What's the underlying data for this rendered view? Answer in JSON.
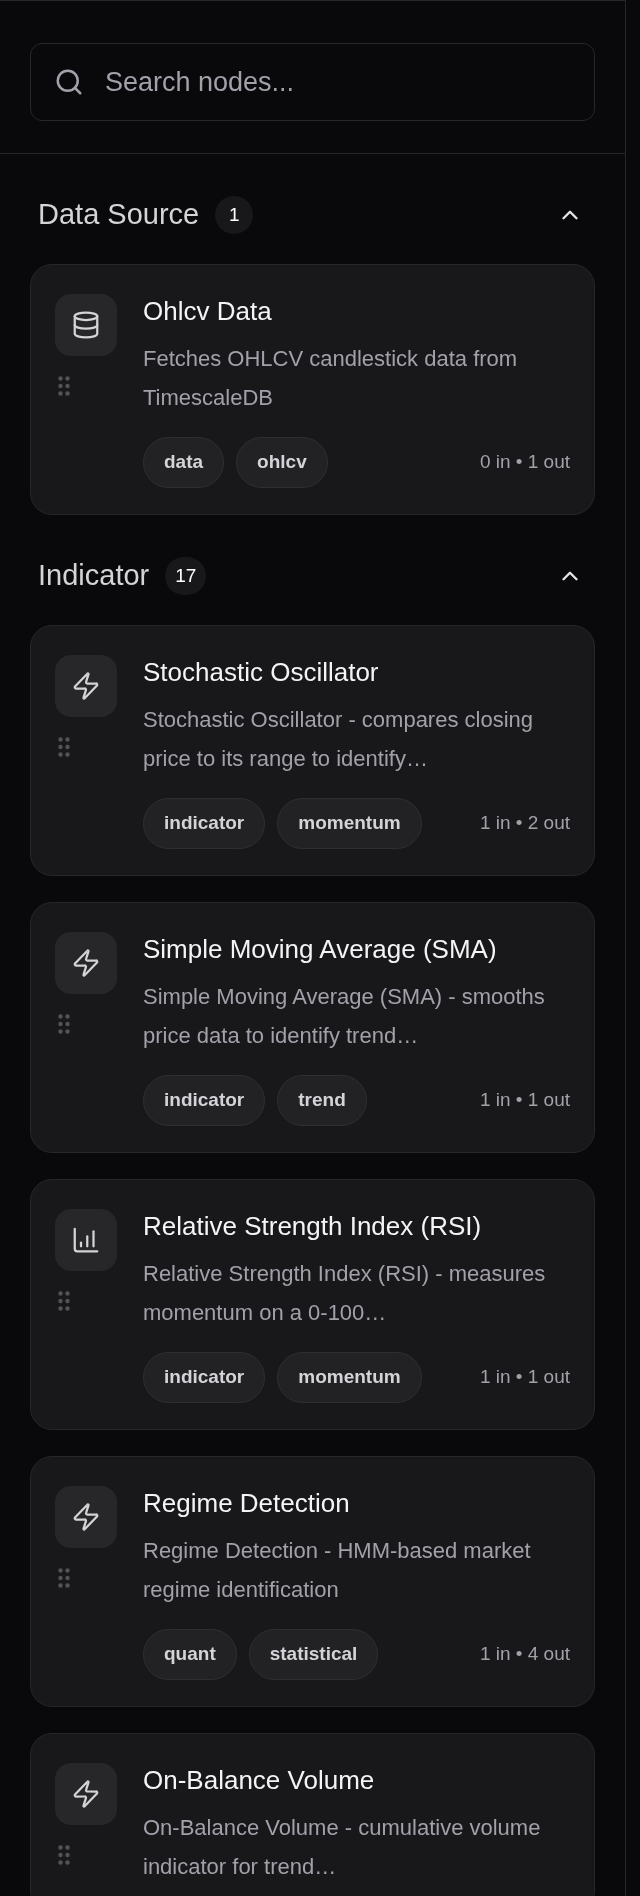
{
  "search": {
    "placeholder": "Search nodes..."
  },
  "sections": [
    {
      "title": "Data Source",
      "count": "1",
      "expanded": true,
      "nodes": [
        {
          "kind": "database",
          "title": "Ohlcv Data",
          "description": "Fetches OHLCV candlestick data from TimescaleDB",
          "tags": [
            "data",
            "ohlcv"
          ],
          "ports": "0 in • 1 out"
        }
      ]
    },
    {
      "title": "Indicator",
      "count": "17",
      "expanded": true,
      "nodes": [
        {
          "kind": "bolt",
          "title": "Stochastic Oscillator",
          "description": "Stochastic Oscillator - compares closing price to its range to identify…",
          "tags": [
            "indicator",
            "momentum"
          ],
          "ports": "1 in • 2 out"
        },
        {
          "kind": "bolt",
          "title": "Simple Moving Average (SMA)",
          "description": "Simple Moving Average (SMA) - smooths price data to identify trend…",
          "tags": [
            "indicator",
            "trend"
          ],
          "ports": "1 in • 1 out"
        },
        {
          "kind": "chart",
          "title": "Relative Strength Index (RSI)",
          "description": "Relative Strength Index (RSI) - measures momentum on a 0-100…",
          "tags": [
            "indicator",
            "momentum"
          ],
          "ports": "1 in • 1 out"
        },
        {
          "kind": "bolt",
          "title": "Regime Detection",
          "description": "Regime Detection - HMM-based market regime identification",
          "tags": [
            "quant",
            "statistical"
          ],
          "ports": "1 in • 4 out"
        },
        {
          "kind": "bolt",
          "title": "On-Balance Volume",
          "description": "On-Balance Volume - cumulative volume indicator for trend…"
        }
      ]
    }
  ]
}
